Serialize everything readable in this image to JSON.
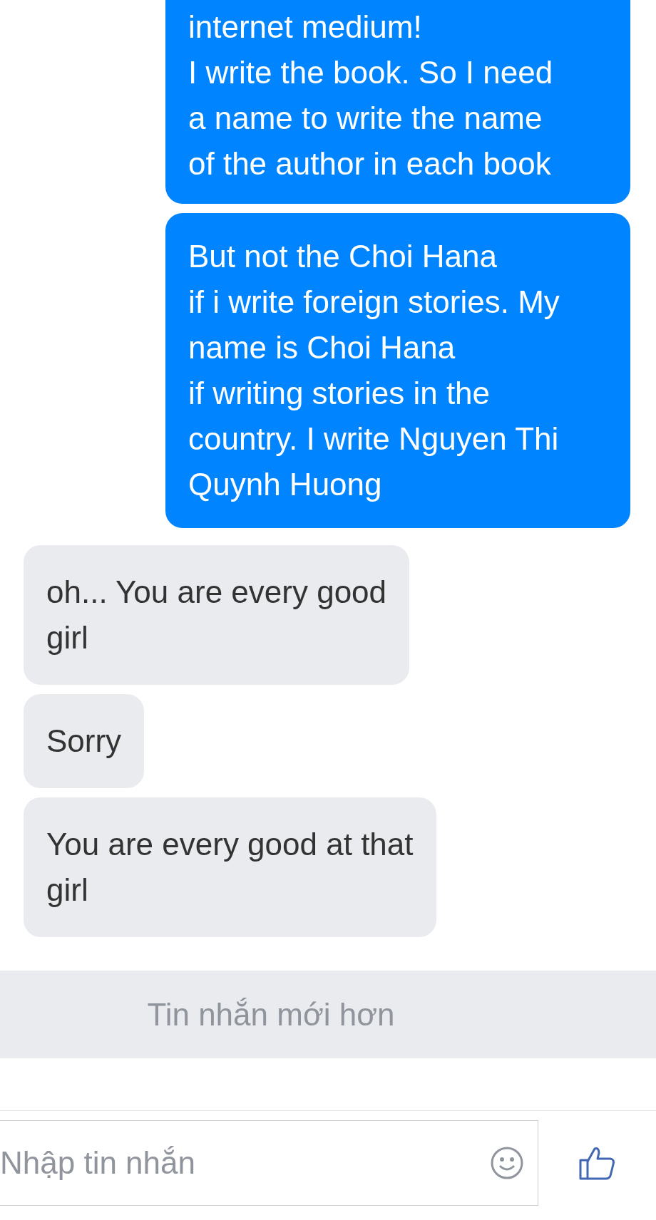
{
  "messages": [
    {
      "kind": "sent",
      "lines": [
        "internet medium!",
        "I write the book. So I need",
        "a name to write the name",
        "of the author in each book"
      ]
    },
    {
      "kind": "sent",
      "lines": [
        "But not the Choi Hana",
        "if i write foreign stories. My",
        "name is Choi Hana",
        "if writing stories in the",
        "country. I write Nguyen Thi",
        "Quynh Huong"
      ]
    },
    {
      "kind": "received",
      "lines": [
        "oh... You are every good",
        "girl"
      ]
    },
    {
      "kind": "received",
      "lines": [
        "Sorry"
      ]
    },
    {
      "kind": "received",
      "lines": [
        "You are every good at that",
        "girl"
      ]
    }
  ],
  "newer_banner": "Tin nhắn mới hơn",
  "composer": {
    "placeholder": "Nhập tin nhắn"
  }
}
